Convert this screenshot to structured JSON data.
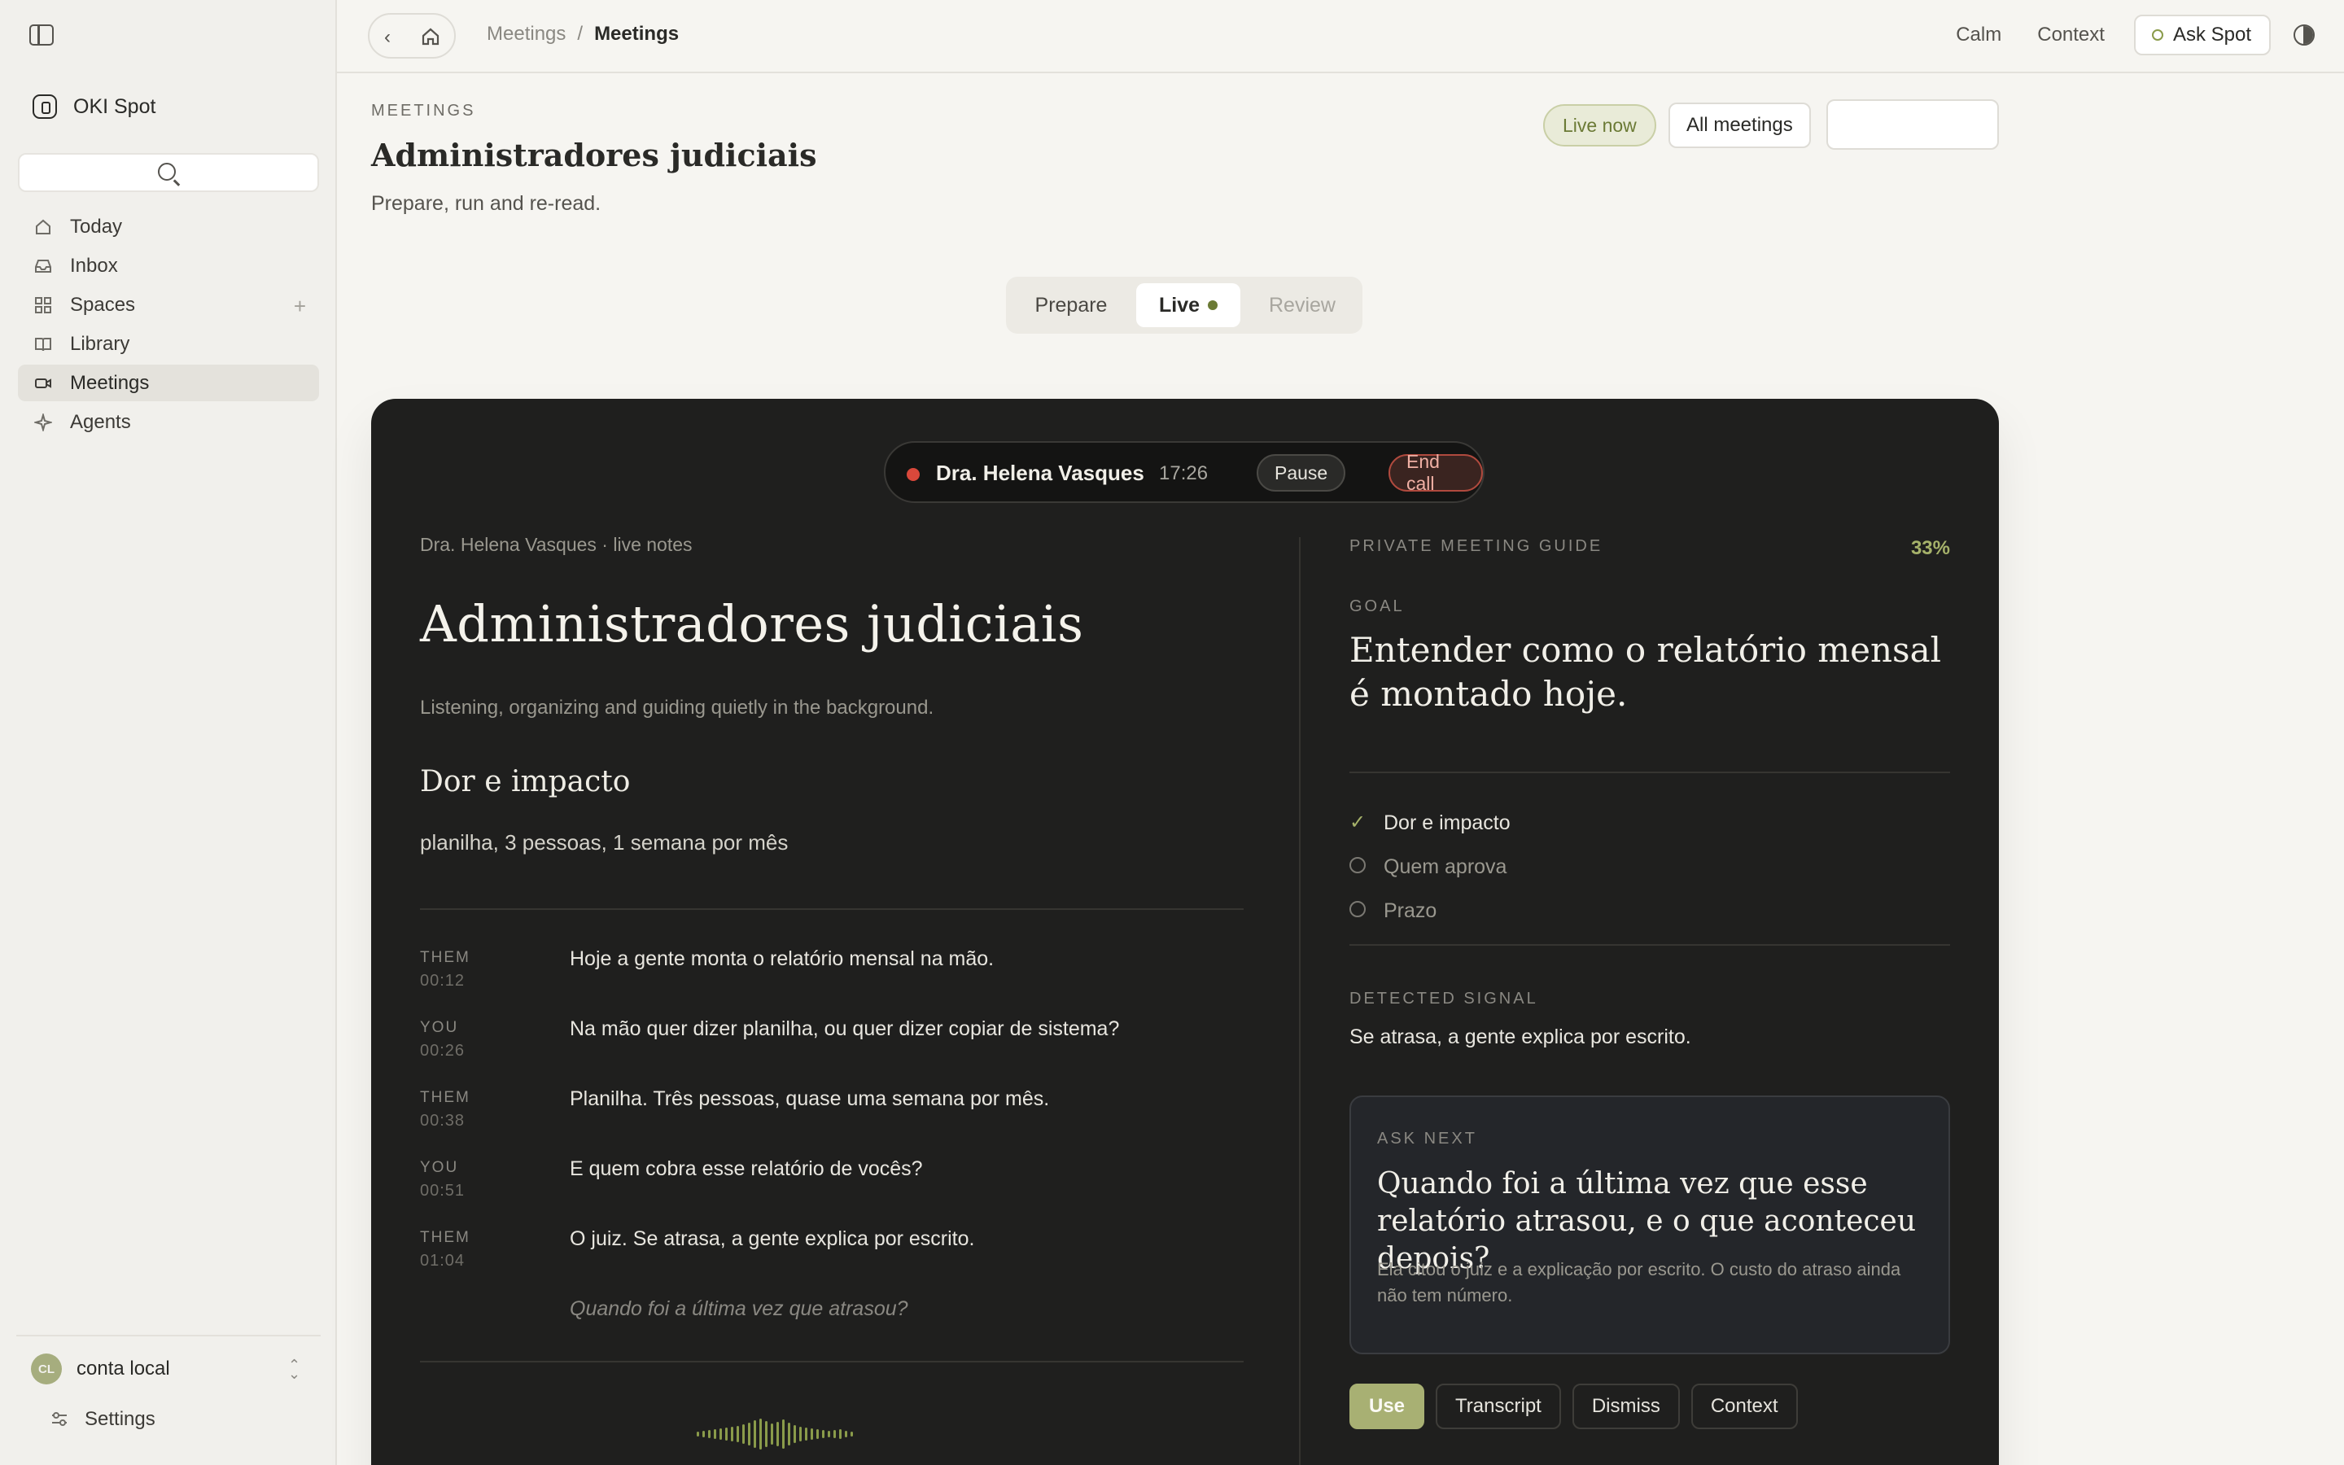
{
  "app": {
    "name": "OKI Spot"
  },
  "sidebar": {
    "items": [
      {
        "label": "Today",
        "icon": "home-icon"
      },
      {
        "label": "Inbox",
        "icon": "inbox-icon"
      },
      {
        "label": "Spaces",
        "icon": "grid-icon"
      },
      {
        "label": "Library",
        "icon": "book-icon"
      },
      {
        "label": "Meetings",
        "icon": "video-icon",
        "active": true
      },
      {
        "label": "Agents",
        "icon": "sparkle-icon"
      }
    ],
    "account": {
      "initials": "CL",
      "label": "conta local"
    },
    "settings_label": "Settings"
  },
  "topbar": {
    "breadcrumb": [
      "Meetings",
      "/",
      "Meetings"
    ],
    "calm_label": "Calm",
    "context_label": "Context",
    "ask_label": "Ask Spot"
  },
  "page": {
    "eyebrow": "MEETINGS",
    "title": "Administradores judiciais",
    "subtitle": "Prepare, run and re-read.",
    "live_now_label": "Live now",
    "all_meetings_label": "All meetings"
  },
  "tabs": {
    "prepare": "Prepare",
    "live": "Live",
    "review": "Review"
  },
  "call": {
    "caller": "Dra. Helena Vasques",
    "timer": "17:26",
    "pause_label": "Pause",
    "end_label": "End call"
  },
  "notes": {
    "label": "Dra. Helena Vasques · live notes",
    "title": "Administradores judiciais",
    "subtitle": "Listening, organizing and guiding quietly in the background.",
    "section_heading": "Dor e impacto",
    "section_text": "planilha, 3 pessoas, 1 semana por mês"
  },
  "transcript": [
    {
      "speaker": "THEM",
      "time": "00:12",
      "text": "Hoje a gente monta o relatório mensal na mão."
    },
    {
      "speaker": "YOU",
      "time": "00:26",
      "text": "Na mão quer dizer planilha, ou quer dizer copiar de sistema?"
    },
    {
      "speaker": "THEM",
      "time": "00:38",
      "text": "Planilha. Três pessoas, quase uma semana por mês."
    },
    {
      "speaker": "YOU",
      "time": "00:51",
      "text": "E quem cobra esse relatório de vocês?"
    },
    {
      "speaker": "THEM",
      "time": "01:04",
      "text": "O juiz. Se atrasa, a gente explica por escrito."
    }
  ],
  "transcript_prompt": "Quando foi a última vez que atrasou?",
  "guide": {
    "label": "PRIVATE MEETING GUIDE",
    "progress_label": "33%",
    "progress": 0.33,
    "goal_label": "GOAL",
    "goal_text": "Entender como o relatório mensal é montado hoje.",
    "checklist": [
      {
        "label": "Dor e impacto",
        "done": true
      },
      {
        "label": "Quem aprova",
        "done": false
      },
      {
        "label": "Prazo",
        "done": false
      }
    ],
    "signal_label": "DETECTED SIGNAL",
    "signal_text": "Se atrasa, a gente explica por escrito.",
    "ask_label": "ASK NEXT",
    "ask_question": "Quando foi a última vez que esse relatório atrasou, e o que aconteceu depois?",
    "ask_note": "Ela citou o juiz e a explicação por escrito. O custo do atraso ainda não tem número.",
    "actions": [
      "Use",
      "Transcript",
      "Dismiss",
      "Context"
    ]
  },
  "colors": {
    "accent": "#a8b073",
    "live_green": "#6b7a35",
    "record_red": "#d9483b",
    "card_bg": "#1f1f1e"
  }
}
